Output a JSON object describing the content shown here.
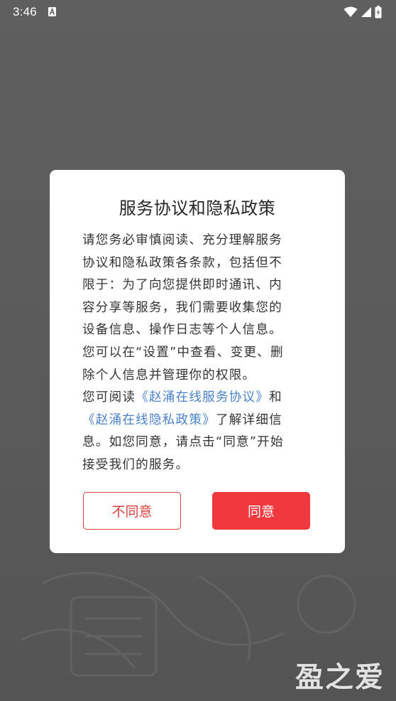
{
  "status_bar": {
    "time": "3:46",
    "icons": [
      "a-notification-icon",
      "wifi-icon",
      "signal-icon",
      "battery-icon"
    ]
  },
  "dialog": {
    "title": "服务协议和隐私政策",
    "body_lines": [
      [
        {
          "text": "请您务必审慎阅读、充分理解服务"
        }
      ],
      [
        {
          "text": "协议和隐私政策各条款，包括但不"
        }
      ],
      [
        {
          "text": "限于：为了向您提供即时通讯、内"
        }
      ],
      [
        {
          "text": "容分享等服务，我们需要收集您的"
        }
      ],
      [
        {
          "text": "设备信息、操作日志等个人信息。"
        }
      ],
      [
        {
          "text": "您可以在“设置”中查看、变更、删"
        }
      ],
      [
        {
          "text": "除个人信息并管理你的权限。"
        }
      ],
      [
        {
          "text": "您可阅读"
        },
        {
          "text": "《赵涌在线服务协议》",
          "link": true
        },
        {
          "text": "和"
        }
      ],
      [
        {
          "text": "《赵涌在线隐私政策》",
          "link": true
        },
        {
          "text": "了解详细信"
        }
      ],
      [
        {
          "text": "息。如您同意，请点击“同意”开始"
        }
      ],
      [
        {
          "text": "接受我们的服务。"
        }
      ]
    ],
    "disagree_label": "不同意",
    "agree_label": "同意"
  },
  "watermark": "盈之爱",
  "colors": {
    "accent_red": "#f0393f",
    "link_blue": "#4a80c8",
    "backdrop": "#5b5b5b"
  }
}
